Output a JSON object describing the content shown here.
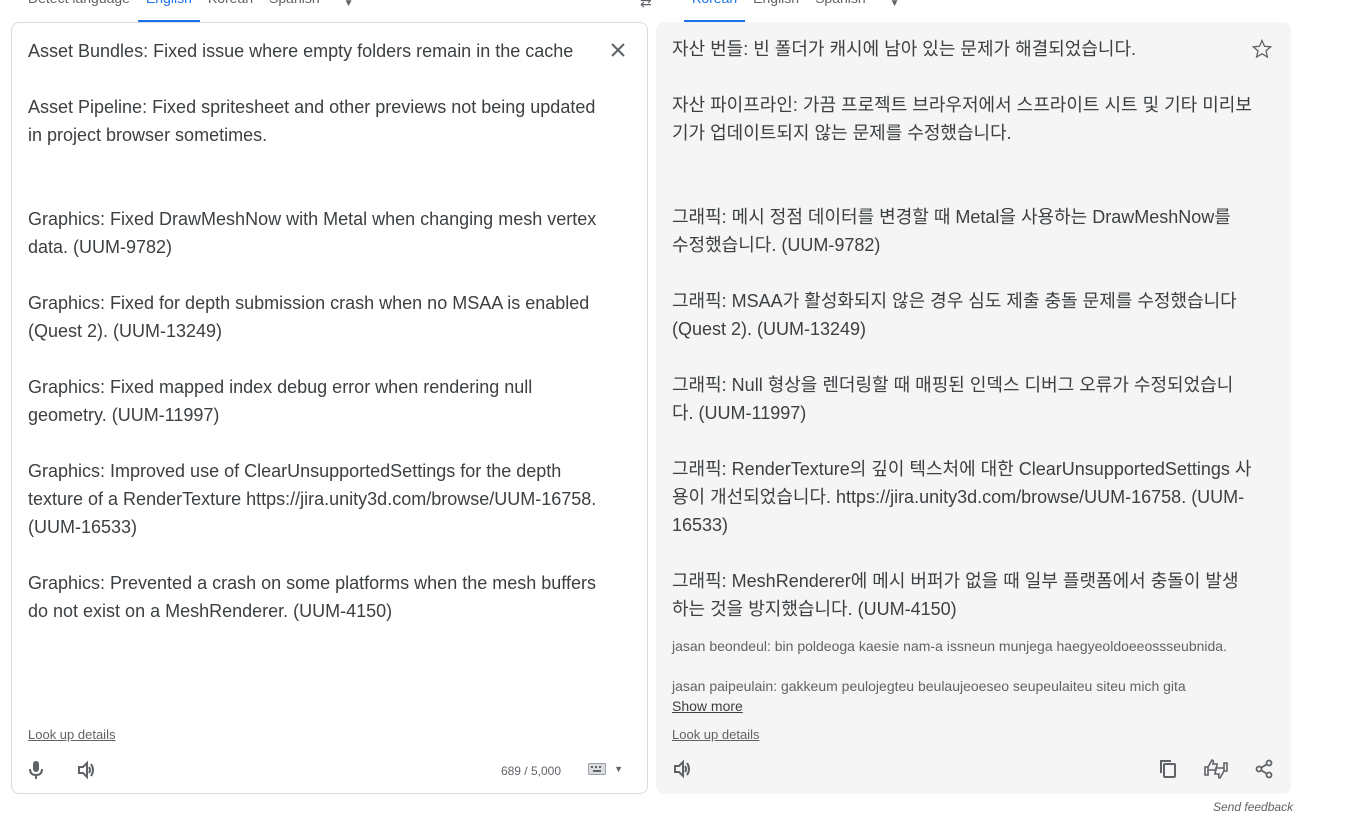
{
  "source_langs": {
    "tabs": [
      "Detect language",
      "English",
      "Korean",
      "Spanish"
    ],
    "active_index": 1
  },
  "target_langs": {
    "tabs": [
      "Korean",
      "English",
      "Spanish"
    ],
    "active_index": 0
  },
  "source": {
    "text": "Asset Bundles: Fixed issue where empty folders remain in the cache\n\nAsset Pipeline: Fixed spritesheet and other previews not being updated in project browser sometimes.\n\n\nGraphics: Fixed DrawMeshNow with Metal when changing mesh vertex data. (UUM-9782)\n\nGraphics: Fixed for depth submission crash when no MSAA is enabled (Quest 2). (UUM-13249)\n\nGraphics: Fixed mapped index debug error when rendering null geometry. (UUM-11997)\n\nGraphics: Improved use of ClearUnsupportedSettings for the depth texture of a RenderTexture https://jira.unity3d.com/browse/UUM-16758. (UUM-16533)\n\nGraphics: Prevented a crash on some platforms when the mesh buffers do not exist on a MeshRenderer. (UUM-4150)",
    "lookup_label": "Look up details",
    "char_count": "689 / 5,000"
  },
  "target": {
    "text": "자산 번들: 빈 폴더가 캐시에 남아 있는 문제가 해결되었습니다.\n\n자산 파이프라인: 가끔 프로젝트 브라우저에서 스프라이트 시트 및 기타 미리보기가 업데이트되지 않는 문제를 수정했습니다.\n\n\n그래픽: 메시 정점 데이터를 변경할 때 Metal을 사용하는 DrawMeshNow를 수정했습니다. (UUM-9782)\n\n그래픽: MSAA가 활성화되지 않은 경우 심도 제출 충돌 문제를 수정했습니다(Quest 2). (UUM-13249)\n\n그래픽: Null 형상을 렌더링할 때 매핑된 인덱스 디버그 오류가 수정되었습니다. (UUM-11997)\n\n그래픽: RenderTexture의 깊이 텍스처에 대한 ClearUnsupportedSettings 사용이 개선되었습니다. https://jira.unity3d.com/browse/UUM-16758. (UUM-16533)\n\n그래픽: MeshRenderer에 메시 버퍼가 없을 때 일부 플랫폼에서 충돌이 발생하는 것을 방지했습니다. (UUM-4150)",
    "romanization": "jasan beondeul: bin poldeoga kaesie nam-a issneun munjega haegyeoldoeeossseubnida.\n\njasan paipeulain: gakkeum peulojegteu beulaujeoeseo seupeulaiteu siteu mich gita",
    "show_more": "Show more",
    "lookup_label": "Look up details"
  },
  "feedback": "Send feedback",
  "icons": {
    "swap": "swap-icon",
    "close": "close-icon",
    "star": "star-icon",
    "mic": "microphone-icon",
    "speaker": "speaker-icon",
    "keyboard": "keyboard-icon",
    "copy": "copy-icon",
    "rate": "thumbs-rating-icon",
    "share": "share-icon"
  },
  "colors": {
    "accent": "#1a73e8",
    "target_bg": "#f5f5f5",
    "border": "#dadce0"
  }
}
